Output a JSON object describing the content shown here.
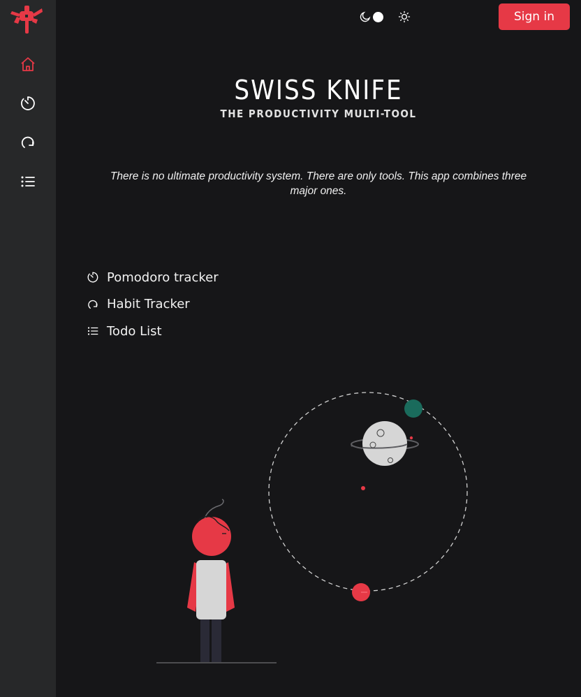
{
  "header": {
    "theme_icons": {
      "dark": "moon-icon",
      "light": "sun-icon"
    },
    "sign_in_label": "Sign in"
  },
  "sidebar": {
    "logo_icon": "swiss-knife-logo-icon",
    "items": [
      {
        "icon": "home-icon",
        "active": true
      },
      {
        "icon": "timer-icon",
        "active": false
      },
      {
        "icon": "habit-loop-icon",
        "active": false
      },
      {
        "icon": "list-icon",
        "active": false
      }
    ]
  },
  "hero": {
    "title": "SWISS KNIFE",
    "subtitle": "THE PRODUCTIVITY MULTI-TOOL",
    "description": "There is no ultimate productivity system. There are only tools. This app combines three major ones."
  },
  "features": [
    {
      "icon": "timer-icon",
      "label": "Pomodoro tracker"
    },
    {
      "icon": "habit-loop-icon",
      "label": "Habit Tracker"
    },
    {
      "icon": "list-icon",
      "label": "Todo List"
    }
  ],
  "colors": {
    "background": "#161618",
    "sidebar": "#272829",
    "accent": "#e63946",
    "teal": "#1a6b5c",
    "planet": "#d6d6d6"
  }
}
